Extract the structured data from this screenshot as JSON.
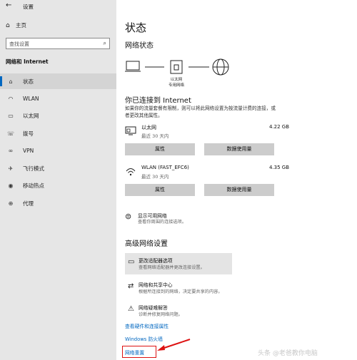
{
  "titlebar": {
    "back": "←",
    "title": "设置"
  },
  "sidebar": {
    "home": {
      "icon": "home-icon",
      "label": "主页"
    },
    "search_placeholder": "查找设置",
    "section_title": "网络和 Internet",
    "items": [
      {
        "icon": "home-icon",
        "label": "状态",
        "active": true
      },
      {
        "icon": "wifi-icon",
        "label": "WLAN"
      },
      {
        "icon": "ethernet-icon",
        "label": "以太网"
      },
      {
        "icon": "phone-icon",
        "label": "拨号"
      },
      {
        "icon": "vpn-icon",
        "label": "VPN"
      },
      {
        "icon": "airplane-icon",
        "label": "飞行模式"
      },
      {
        "icon": "hotspot-icon",
        "label": "移动热点"
      },
      {
        "icon": "globe-icon",
        "label": "代理"
      }
    ]
  },
  "main": {
    "page_title": "状态",
    "network_status_title": "网络状态",
    "diagram": {
      "label_line1": "以太网",
      "label_line2": "专用网络"
    },
    "connected_title": "你已连接到 Internet",
    "connected_desc": "如果你的流量套餐有限制，则可以将此网络设置为按流量计费的连接，或者更改其他属性。",
    "connections": [
      {
        "icon": "ethernet-pc-icon",
        "name": "以太网",
        "usage": "最近 30 天内",
        "size": "4.22 GB",
        "btn_props": "属性",
        "btn_usage": "数据使用量"
      },
      {
        "icon": "wifi-icon",
        "name": "WLAN (FAST_EFC6)",
        "usage": "最近 30 天内",
        "size": "4.35 GB",
        "btn_props": "属性",
        "btn_usage": "数据使用量"
      }
    ],
    "show_networks": {
      "title": "显示可用网络",
      "desc": "查看你周围的连接选项。"
    },
    "advanced_title": "高级网络设置",
    "advanced_items": [
      {
        "title": "更改适配器选项",
        "desc": "查看网络适配器并更改连接设置。"
      },
      {
        "title": "网络和共享中心",
        "desc": "根据所连接到的网络，决定要共享的内容。"
      },
      {
        "title": "网络疑难解答",
        "desc": "诊断并修复网络问题。"
      }
    ],
    "links": {
      "hardware": "查看硬件和连接属性",
      "firewall": "Windows 防火墙",
      "reset": "网络重置"
    }
  },
  "watermark": "头条 @老爸教你电脑",
  "colors": {
    "accent": "#0067c0",
    "highlight_box": "#dd1111",
    "sidebar_bg": "#e6e6e6",
    "button_bg": "#cccccc"
  }
}
